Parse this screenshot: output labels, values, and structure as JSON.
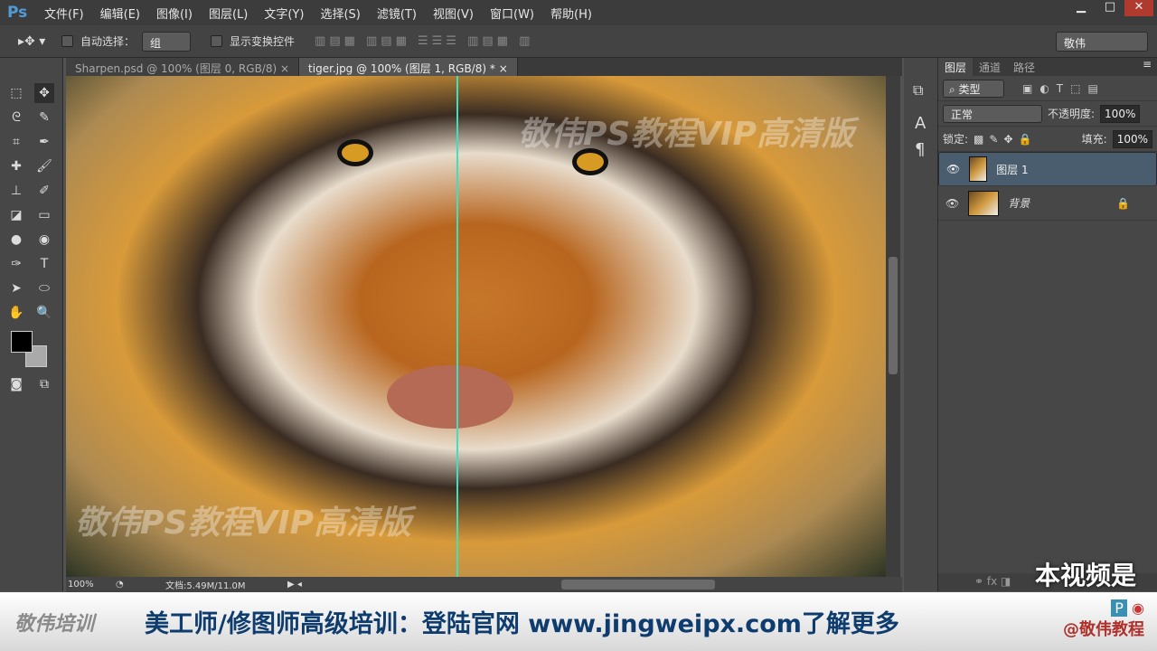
{
  "app": {
    "logo": "Ps",
    "menu": [
      "文件(F)",
      "编辑(E)",
      "图像(I)",
      "图层(L)",
      "文字(Y)",
      "选择(S)",
      "滤镜(T)",
      "视图(V)",
      "窗口(W)",
      "帮助(H)"
    ],
    "window_buttons": [
      "▁",
      "□",
      "✕"
    ]
  },
  "options": {
    "auto_select_label": "自动选择：",
    "auto_select_value": "组",
    "show_transform_label": "显示变换控件",
    "workspace": "敬伟"
  },
  "tabs": [
    {
      "label": "Sharpen.psd @ 100% (图层 0, RGB/8)",
      "close": "×"
    },
    {
      "label": "tiger.jpg @ 100% (图层 1, RGB/8) *",
      "close": "×"
    }
  ],
  "canvas": {
    "watermark": "敬伟PS教程VIP高清版"
  },
  "status": {
    "zoom": "100%",
    "doc": "文档:5.49M/11.0M"
  },
  "layers_panel": {
    "tabs": [
      "图层",
      "通道",
      "路径"
    ],
    "filter": "类型",
    "blend_mode": "正常",
    "opacity_label": "不透明度:",
    "opacity": "100%",
    "lock_label": "锁定:",
    "fill_label": "填充:",
    "fill": "100%",
    "layers": [
      {
        "name": "图层 1",
        "selected": true
      },
      {
        "name": "背景",
        "locked": true
      }
    ]
  },
  "banner": {
    "logo": "敬伟培训",
    "text": "美工师/修图师高级培训：登陆官网 www.jingweipx.com了解更多",
    "handle": "@敬伟教程",
    "overlay": "本视频是"
  },
  "colors": {
    "accent": "#4f9cd8",
    "guide": "#3fe0c0",
    "banner_text": "#0e3c6e"
  }
}
